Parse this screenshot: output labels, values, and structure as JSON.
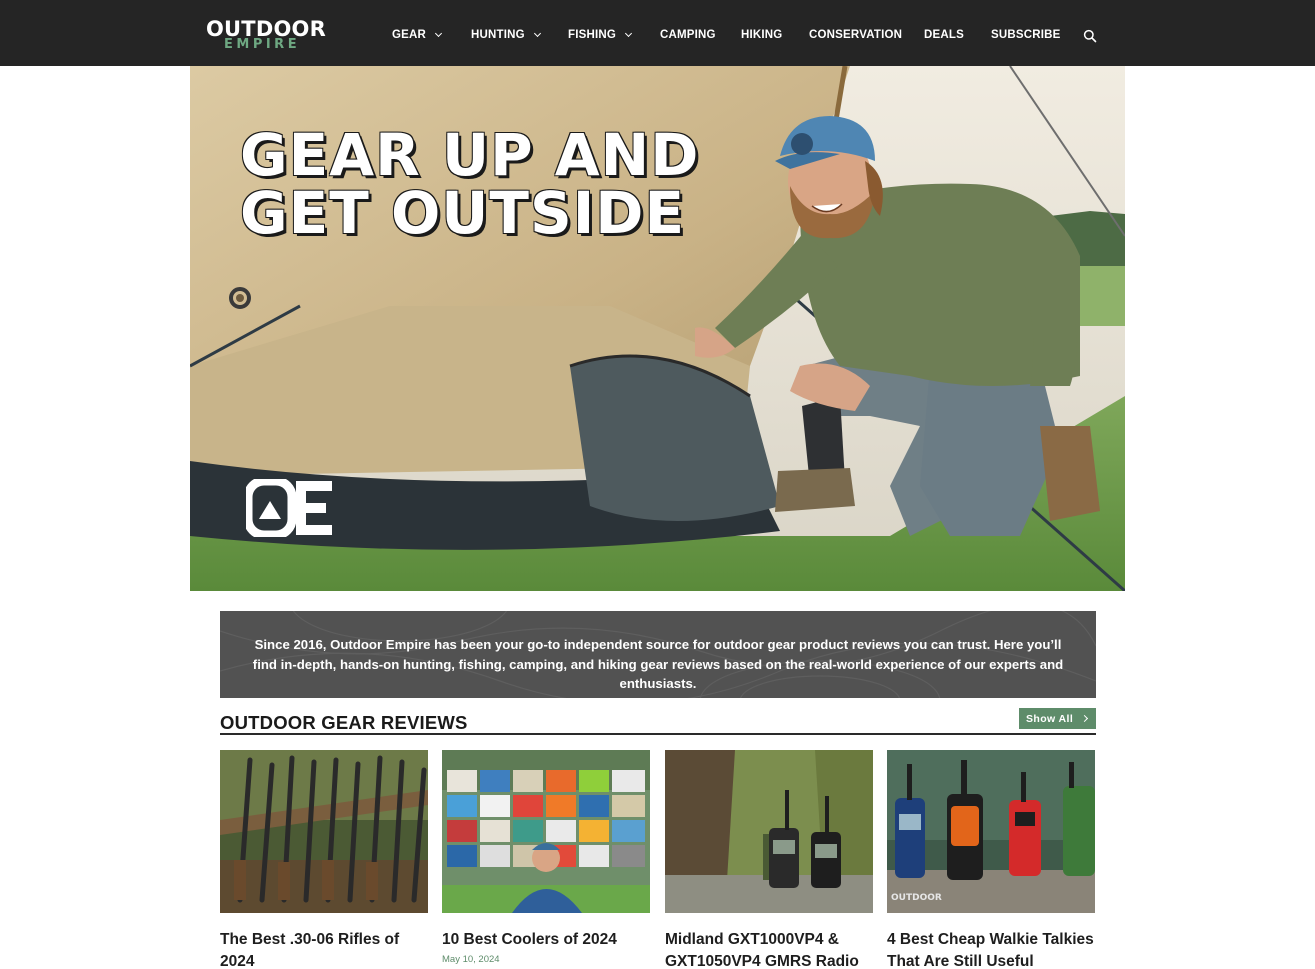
{
  "header": {
    "logo_top": "OUTDOOR",
    "logo_bottom": "EMPIRE",
    "nav": [
      {
        "label": "GEAR",
        "has_dropdown": true
      },
      {
        "label": "HUNTING",
        "has_dropdown": true
      },
      {
        "label": "FISHING",
        "has_dropdown": true
      },
      {
        "label": "CAMPING",
        "has_dropdown": false
      },
      {
        "label": "HIKING",
        "has_dropdown": false
      },
      {
        "label": "CONSERVATION",
        "has_dropdown": false
      },
      {
        "label": "DEALS",
        "has_dropdown": false
      },
      {
        "label": "SUBSCRIBE",
        "has_dropdown": false
      }
    ],
    "search_icon": "search-icon"
  },
  "hero": {
    "headline_line1": "GEAR UP AND",
    "headline_line2": "GET OUTSIDE",
    "badge_text": "OE"
  },
  "intro": {
    "text": "Since 2016, Outdoor Empire has been your go-to independent source for outdoor gear product reviews you can trust. Here you’ll find in-depth, hands-on hunting, fishing, camping, and hiking gear reviews based on the real-world experience of our experts and enthusiasts."
  },
  "reviews": {
    "title": "OUTDOOR GEAR REVIEWS",
    "show_all": "Show All",
    "cards": [
      {
        "title": "The Best .30-06 Rifles of 2024",
        "date": ""
      },
      {
        "title": "10 Best Coolers of 2024",
        "date": "May 10, 2024"
      },
      {
        "title": "Midland GXT1000VP4 & GXT1050VP4 GMRS Radio",
        "date": ""
      },
      {
        "title": "4 Best Cheap Walkie Talkies That Are Still Useful",
        "date": ""
      }
    ]
  },
  "colors": {
    "header_bg": "#252525",
    "accent_green": "#5e8c6a",
    "intro_bg": "#525252"
  }
}
